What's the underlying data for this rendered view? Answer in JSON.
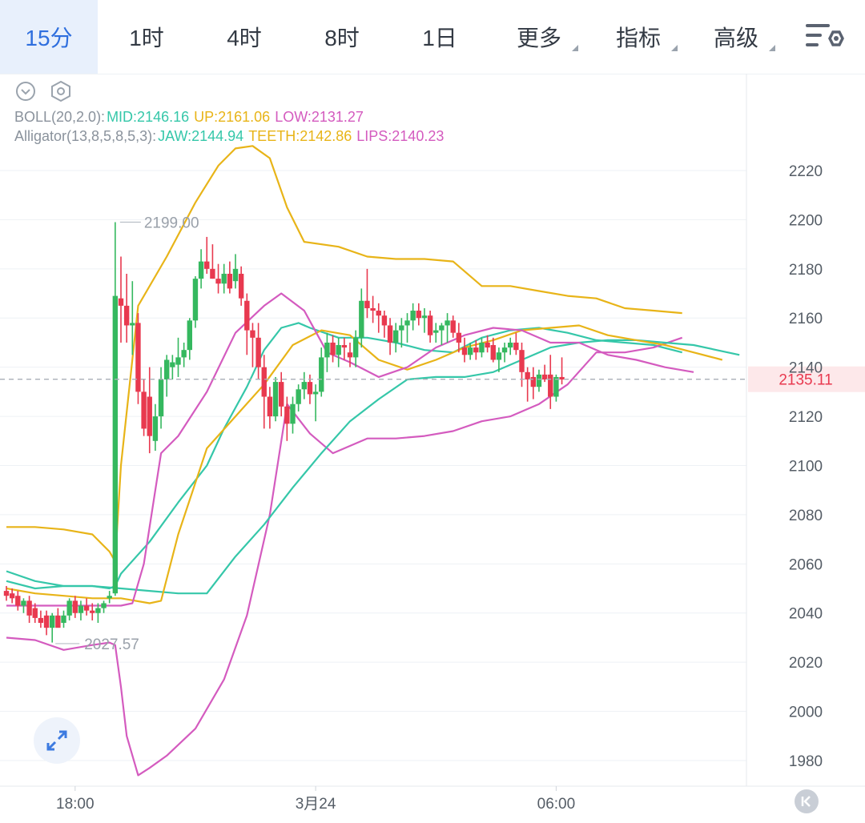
{
  "tabs": [
    {
      "label": "15分",
      "active": true
    },
    {
      "label": "1时",
      "active": false
    },
    {
      "label": "4时",
      "active": false
    },
    {
      "label": "8时",
      "active": false
    },
    {
      "label": "1日",
      "active": false
    },
    {
      "label": "更多",
      "active": false,
      "dropdown": true
    },
    {
      "label": "指标",
      "active": false,
      "dropdown": true
    },
    {
      "label": "高级",
      "active": false,
      "dropdown": true
    }
  ],
  "toolbar": {
    "icons": [
      "collapse-chevron-icon",
      "settings-hexagon-icon",
      "chart-settings-icon",
      "expand-arrows-icon",
      "reset-to-latest-icon"
    ]
  },
  "boll": {
    "name": "BOLL(20,2.0):",
    "mid": "MID:2146.16",
    "up": "UP:2161.06",
    "low": "LOW:2131.27"
  },
  "alligator": {
    "name": "Alligator(13,8,5,8,5,3):",
    "jaw": "JAW:2144.94",
    "teeth": "TEETH:2142.86",
    "lips": "LIPS:2140.23"
  },
  "colors": {
    "up": "#35b85f",
    "down": "#e8394f",
    "mid": "#35c7a9",
    "upper": "#e8b418",
    "lower": "#d45bbf",
    "jaw": "#35c7a9",
    "teeth": "#e8b418",
    "lips": "#d45bbf",
    "accent": "#2f6fde",
    "axis_text": "#555d66",
    "grid": "#eef1f5"
  },
  "chart_data": {
    "type": "candlestick",
    "ylim": [
      1970,
      2230
    ],
    "yticks": [
      2220,
      2200,
      2180,
      2160,
      2140,
      2120,
      2100,
      2080,
      2060,
      2040,
      2020,
      2000,
      1980
    ],
    "xticks": [
      {
        "index": 12,
        "label": "18:00"
      },
      {
        "index": 54,
        "label": "3月24"
      },
      {
        "index": 96,
        "label": "06:00"
      }
    ],
    "current_price": 2135.11,
    "high_label": {
      "index": 19,
      "value": 2199.0,
      "text": "2199.00"
    },
    "low_label": {
      "index": 8,
      "value": 2027.57,
      "text": "2027.57"
    },
    "candles": [
      [
        2049,
        2051,
        2045,
        2047
      ],
      [
        2048,
        2050,
        2044,
        2046
      ],
      [
        2047,
        2049,
        2041,
        2043
      ],
      [
        2043,
        2046,
        2040,
        2045
      ],
      [
        2045,
        2047,
        2036,
        2039
      ],
      [
        2042,
        2044,
        2036,
        2038
      ],
      [
        2038,
        2041,
        2034,
        2036
      ],
      [
        2039,
        2041,
        2031,
        2034
      ],
      [
        2034,
        2040,
        2028,
        2039
      ],
      [
        2039,
        2042,
        2035,
        2034
      ],
      [
        2036,
        2041,
        2034,
        2039
      ],
      [
        2039,
        2046,
        2037,
        2045
      ],
      [
        2045,
        2047,
        2038,
        2040
      ],
      [
        2040,
        2045,
        2037,
        2043
      ],
      [
        2043,
        2046,
        2039,
        2041
      ],
      [
        2041,
        2044,
        2037,
        2040
      ],
      [
        2040,
        2044,
        2036,
        2042
      ],
      [
        2042,
        2045,
        2040,
        2044
      ],
      [
        2046,
        2049,
        2044,
        2047
      ],
      [
        2048,
        2199,
        2047,
        2169
      ],
      [
        2168,
        2185,
        2150,
        2165
      ],
      [
        2165,
        2178,
        2150,
        2157
      ],
      [
        2157,
        2175,
        2145,
        2158
      ],
      [
        2158,
        2162,
        2125,
        2130
      ],
      [
        2130,
        2135,
        2112,
        2115
      ],
      [
        2128,
        2140,
        2105,
        2112
      ],
      [
        2110,
        2125,
        2106,
        2120
      ],
      [
        2120,
        2140,
        2115,
        2135
      ],
      [
        2135,
        2145,
        2128,
        2143
      ],
      [
        2140,
        2145,
        2135,
        2142
      ],
      [
        2141,
        2152,
        2136,
        2144
      ],
      [
        2144,
        2150,
        2140,
        2147
      ],
      [
        2147,
        2160,
        2143,
        2159
      ],
      [
        2159,
        2177,
        2156,
        2176
      ],
      [
        2176,
        2188,
        2172,
        2183
      ],
      [
        2183,
        2193,
        2178,
        2180
      ],
      [
        2180,
        2190,
        2176,
        2176
      ],
      [
        2176,
        2182,
        2170,
        2174
      ],
      [
        2174,
        2182,
        2170,
        2178
      ],
      [
        2178,
        2183,
        2170,
        2172
      ],
      [
        2175,
        2186,
        2172,
        2180
      ],
      [
        2178,
        2181,
        2165,
        2168
      ],
      [
        2167,
        2170,
        2145,
        2155
      ],
      [
        2155,
        2158,
        2140,
        2152
      ],
      [
        2152,
        2158,
        2135,
        2140
      ],
      [
        2140,
        2145,
        2115,
        2128
      ],
      [
        2128,
        2132,
        2115,
        2120
      ],
      [
        2120,
        2136,
        2118,
        2134
      ],
      [
        2134,
        2138,
        2120,
        2124
      ],
      [
        2124,
        2128,
        2110,
        2117
      ],
      [
        2117,
        2128,
        2113,
        2125
      ],
      [
        2125,
        2133,
        2122,
        2131
      ],
      [
        2131,
        2138,
        2127,
        2134
      ],
      [
        2134,
        2137,
        2125,
        2129
      ],
      [
        2129,
        2133,
        2118,
        2130
      ],
      [
        2130,
        2148,
        2128,
        2144
      ],
      [
        2144,
        2154,
        2138,
        2150
      ],
      [
        2150,
        2153,
        2142,
        2145
      ],
      [
        2145,
        2152,
        2140,
        2149
      ],
      [
        2149,
        2152,
        2143,
        2148
      ],
      [
        2146,
        2150,
        2140,
        2144
      ],
      [
        2144,
        2155,
        2140,
        2152
      ],
      [
        2152,
        2172,
        2148,
        2167
      ],
      [
        2167,
        2180,
        2160,
        2164
      ],
      [
        2164,
        2169,
        2158,
        2163
      ],
      [
        2163,
        2166,
        2154,
        2161
      ],
      [
        2161,
        2163,
        2152,
        2157
      ],
      [
        2157,
        2160,
        2145,
        2150
      ],
      [
        2150,
        2158,
        2146,
        2155
      ],
      [
        2155,
        2160,
        2148,
        2157
      ],
      [
        2157,
        2162,
        2150,
        2159
      ],
      [
        2159,
        2166,
        2155,
        2163
      ],
      [
        2163,
        2166,
        2157,
        2160
      ],
      [
        2160,
        2164,
        2154,
        2161
      ],
      [
        2161,
        2163,
        2150,
        2153
      ],
      [
        2154,
        2158,
        2150,
        2155
      ],
      [
        2155,
        2158,
        2149,
        2157
      ],
      [
        2157,
        2162,
        2150,
        2159
      ],
      [
        2159,
        2161,
        2152,
        2154
      ],
      [
        2154,
        2158,
        2146,
        2150
      ],
      [
        2148,
        2152,
        2142,
        2145
      ],
      [
        2145,
        2150,
        2143,
        2148
      ],
      [
        2148,
        2151,
        2143,
        2146
      ],
      [
        2146,
        2152,
        2144,
        2150
      ],
      [
        2150,
        2153,
        2146,
        2148
      ],
      [
        2149,
        2152,
        2142,
        2143
      ],
      [
        2143,
        2148,
        2138,
        2146
      ],
      [
        2146,
        2150,
        2142,
        2148
      ],
      [
        2148,
        2152,
        2145,
        2150
      ],
      [
        2150,
        2154,
        2145,
        2147
      ],
      [
        2147,
        2150,
        2132,
        2138
      ],
      [
        2138,
        2140,
        2126,
        2135
      ],
      [
        2136,
        2140,
        2127,
        2132
      ],
      [
        2132,
        2139,
        2130,
        2137
      ],
      [
        2137,
        2141,
        2134,
        2135
      ],
      [
        2137,
        2145,
        2123,
        2128
      ],
      [
        2128,
        2137,
        2126,
        2136
      ],
      [
        2136,
        2144,
        2133,
        2135
      ]
    ],
    "series": [
      {
        "key": "mid",
        "values": [
          [
            0,
            2053
          ],
          [
            5,
            2050
          ],
          [
            10,
            2051
          ],
          [
            15,
            2051
          ],
          [
            18,
            2050
          ],
          [
            19,
            2051
          ],
          [
            20,
            2056
          ],
          [
            25,
            2069
          ],
          [
            30,
            2085
          ],
          [
            35,
            2100
          ],
          [
            38,
            2115
          ],
          [
            42,
            2132
          ],
          [
            45,
            2147
          ],
          [
            48,
            2156
          ],
          [
            51,
            2158
          ],
          [
            53,
            2156
          ],
          [
            58,
            2152
          ],
          [
            63,
            2152
          ],
          [
            68,
            2150
          ],
          [
            73,
            2147
          ],
          [
            78,
            2146
          ],
          [
            83,
            2152
          ],
          [
            88,
            2155
          ],
          [
            93,
            2156
          ],
          [
            98,
            2154
          ],
          [
            103,
            2151
          ],
          [
            108,
            2150
          ],
          [
            113,
            2149
          ],
          [
            118,
            2146
          ]
        ]
      },
      {
        "key": "upper",
        "values": [
          [
            0,
            2075
          ],
          [
            5,
            2075
          ],
          [
            10,
            2074
          ],
          [
            15,
            2072
          ],
          [
            18,
            2065
          ],
          [
            19,
            2061
          ],
          [
            20,
            2100
          ],
          [
            23,
            2165
          ],
          [
            28,
            2185
          ],
          [
            33,
            2207
          ],
          [
            37,
            2222
          ],
          [
            40,
            2229
          ],
          [
            43,
            2230
          ],
          [
            46,
            2225
          ],
          [
            49,
            2205
          ],
          [
            52,
            2191
          ],
          [
            58,
            2189
          ],
          [
            63,
            2185
          ],
          [
            68,
            2184
          ],
          [
            73,
            2184
          ],
          [
            78,
            2183
          ],
          [
            83,
            2173
          ],
          [
            88,
            2173
          ],
          [
            93,
            2171
          ],
          [
            98,
            2169
          ],
          [
            103,
            2168
          ],
          [
            108,
            2164
          ],
          [
            113,
            2163
          ],
          [
            118,
            2162
          ]
        ]
      },
      {
        "key": "lower",
        "values": [
          [
            0,
            2030
          ],
          [
            5,
            2029
          ],
          [
            10,
            2025
          ],
          [
            15,
            2027
          ],
          [
            18,
            2028
          ],
          [
            19,
            2027
          ],
          [
            20,
            2010
          ],
          [
            21,
            1990
          ],
          [
            23,
            1974
          ],
          [
            25,
            1977
          ],
          [
            28,
            1982
          ],
          [
            33,
            1993
          ],
          [
            38,
            2013
          ],
          [
            42,
            2039
          ],
          [
            46,
            2080
          ],
          [
            49,
            2125
          ],
          [
            53,
            2113
          ],
          [
            57,
            2105
          ],
          [
            63,
            2111
          ],
          [
            68,
            2111
          ],
          [
            73,
            2112
          ],
          [
            78,
            2114
          ],
          [
            83,
            2118
          ],
          [
            88,
            2120
          ],
          [
            93,
            2125
          ],
          [
            98,
            2133
          ],
          [
            103,
            2146
          ],
          [
            108,
            2146
          ],
          [
            113,
            2148
          ],
          [
            118,
            2152
          ]
        ]
      },
      {
        "key": "jaw",
        "values": [
          [
            0,
            2057
          ],
          [
            5,
            2053
          ],
          [
            10,
            2051
          ],
          [
            15,
            2051
          ],
          [
            20,
            2050
          ],
          [
            25,
            2049
          ],
          [
            30,
            2048
          ],
          [
            35,
            2048
          ],
          [
            40,
            2063
          ],
          [
            45,
            2076
          ],
          [
            50,
            2091
          ],
          [
            55,
            2105
          ],
          [
            60,
            2118
          ],
          [
            65,
            2127
          ],
          [
            70,
            2135
          ],
          [
            75,
            2136
          ],
          [
            80,
            2136
          ],
          [
            85,
            2138
          ],
          [
            90,
            2143
          ],
          [
            95,
            2148
          ],
          [
            100,
            2150
          ],
          [
            105,
            2151
          ],
          [
            110,
            2151
          ],
          [
            115,
            2150
          ],
          [
            120,
            2149
          ],
          [
            128,
            2145
          ]
        ]
      },
      {
        "key": "teeth",
        "values": [
          [
            0,
            2050
          ],
          [
            5,
            2048
          ],
          [
            10,
            2047
          ],
          [
            15,
            2046
          ],
          [
            20,
            2046
          ],
          [
            25,
            2044
          ],
          [
            27,
            2045
          ],
          [
            30,
            2072
          ],
          [
            35,
            2107
          ],
          [
            40,
            2120
          ],
          [
            45,
            2133
          ],
          [
            50,
            2149
          ],
          [
            55,
            2155
          ],
          [
            60,
            2153
          ],
          [
            65,
            2143
          ],
          [
            70,
            2139
          ],
          [
            75,
            2143
          ],
          [
            80,
            2148
          ],
          [
            85,
            2151
          ],
          [
            90,
            2155
          ],
          [
            95,
            2156
          ],
          [
            100,
            2157
          ],
          [
            105,
            2153
          ],
          [
            110,
            2151
          ],
          [
            115,
            2149
          ],
          [
            120,
            2146
          ],
          [
            125,
            2143
          ]
        ]
      },
      {
        "key": "lips",
        "values": [
          [
            0,
            2043
          ],
          [
            5,
            2043
          ],
          [
            10,
            2043
          ],
          [
            15,
            2043
          ],
          [
            20,
            2043
          ],
          [
            22,
            2044
          ],
          [
            24,
            2060
          ],
          [
            27,
            2105
          ],
          [
            30,
            2112
          ],
          [
            35,
            2130
          ],
          [
            40,
            2154
          ],
          [
            45,
            2165
          ],
          [
            48,
            2170
          ],
          [
            52,
            2163
          ],
          [
            56,
            2146
          ],
          [
            60,
            2142
          ],
          [
            65,
            2136
          ],
          [
            70,
            2140
          ],
          [
            75,
            2148
          ],
          [
            80,
            2153
          ],
          [
            85,
            2156
          ],
          [
            90,
            2155
          ],
          [
            95,
            2150
          ],
          [
            100,
            2150
          ],
          [
            105,
            2145
          ],
          [
            110,
            2143
          ],
          [
            115,
            2140
          ],
          [
            120,
            2138
          ]
        ]
      }
    ]
  }
}
